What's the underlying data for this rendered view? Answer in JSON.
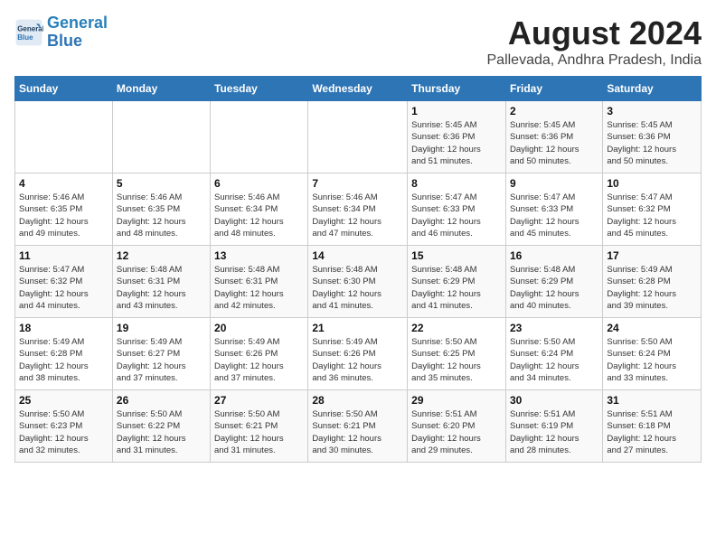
{
  "header": {
    "logo_line1": "General",
    "logo_line2": "Blue",
    "title": "August 2024",
    "subtitle": "Pallevada, Andhra Pradesh, India"
  },
  "days_of_week": [
    "Sunday",
    "Monday",
    "Tuesday",
    "Wednesday",
    "Thursday",
    "Friday",
    "Saturday"
  ],
  "weeks": [
    [
      {
        "day": "",
        "info": ""
      },
      {
        "day": "",
        "info": ""
      },
      {
        "day": "",
        "info": ""
      },
      {
        "day": "",
        "info": ""
      },
      {
        "day": "1",
        "info": "Sunrise: 5:45 AM\nSunset: 6:36 PM\nDaylight: 12 hours\nand 51 minutes."
      },
      {
        "day": "2",
        "info": "Sunrise: 5:45 AM\nSunset: 6:36 PM\nDaylight: 12 hours\nand 50 minutes."
      },
      {
        "day": "3",
        "info": "Sunrise: 5:45 AM\nSunset: 6:36 PM\nDaylight: 12 hours\nand 50 minutes."
      }
    ],
    [
      {
        "day": "4",
        "info": "Sunrise: 5:46 AM\nSunset: 6:35 PM\nDaylight: 12 hours\nand 49 minutes."
      },
      {
        "day": "5",
        "info": "Sunrise: 5:46 AM\nSunset: 6:35 PM\nDaylight: 12 hours\nand 48 minutes."
      },
      {
        "day": "6",
        "info": "Sunrise: 5:46 AM\nSunset: 6:34 PM\nDaylight: 12 hours\nand 48 minutes."
      },
      {
        "day": "7",
        "info": "Sunrise: 5:46 AM\nSunset: 6:34 PM\nDaylight: 12 hours\nand 47 minutes."
      },
      {
        "day": "8",
        "info": "Sunrise: 5:47 AM\nSunset: 6:33 PM\nDaylight: 12 hours\nand 46 minutes."
      },
      {
        "day": "9",
        "info": "Sunrise: 5:47 AM\nSunset: 6:33 PM\nDaylight: 12 hours\nand 45 minutes."
      },
      {
        "day": "10",
        "info": "Sunrise: 5:47 AM\nSunset: 6:32 PM\nDaylight: 12 hours\nand 45 minutes."
      }
    ],
    [
      {
        "day": "11",
        "info": "Sunrise: 5:47 AM\nSunset: 6:32 PM\nDaylight: 12 hours\nand 44 minutes."
      },
      {
        "day": "12",
        "info": "Sunrise: 5:48 AM\nSunset: 6:31 PM\nDaylight: 12 hours\nand 43 minutes."
      },
      {
        "day": "13",
        "info": "Sunrise: 5:48 AM\nSunset: 6:31 PM\nDaylight: 12 hours\nand 42 minutes."
      },
      {
        "day": "14",
        "info": "Sunrise: 5:48 AM\nSunset: 6:30 PM\nDaylight: 12 hours\nand 41 minutes."
      },
      {
        "day": "15",
        "info": "Sunrise: 5:48 AM\nSunset: 6:29 PM\nDaylight: 12 hours\nand 41 minutes."
      },
      {
        "day": "16",
        "info": "Sunrise: 5:48 AM\nSunset: 6:29 PM\nDaylight: 12 hours\nand 40 minutes."
      },
      {
        "day": "17",
        "info": "Sunrise: 5:49 AM\nSunset: 6:28 PM\nDaylight: 12 hours\nand 39 minutes."
      }
    ],
    [
      {
        "day": "18",
        "info": "Sunrise: 5:49 AM\nSunset: 6:28 PM\nDaylight: 12 hours\nand 38 minutes."
      },
      {
        "day": "19",
        "info": "Sunrise: 5:49 AM\nSunset: 6:27 PM\nDaylight: 12 hours\nand 37 minutes."
      },
      {
        "day": "20",
        "info": "Sunrise: 5:49 AM\nSunset: 6:26 PM\nDaylight: 12 hours\nand 37 minutes."
      },
      {
        "day": "21",
        "info": "Sunrise: 5:49 AM\nSunset: 6:26 PM\nDaylight: 12 hours\nand 36 minutes."
      },
      {
        "day": "22",
        "info": "Sunrise: 5:50 AM\nSunset: 6:25 PM\nDaylight: 12 hours\nand 35 minutes."
      },
      {
        "day": "23",
        "info": "Sunrise: 5:50 AM\nSunset: 6:24 PM\nDaylight: 12 hours\nand 34 minutes."
      },
      {
        "day": "24",
        "info": "Sunrise: 5:50 AM\nSunset: 6:24 PM\nDaylight: 12 hours\nand 33 minutes."
      }
    ],
    [
      {
        "day": "25",
        "info": "Sunrise: 5:50 AM\nSunset: 6:23 PM\nDaylight: 12 hours\nand 32 minutes."
      },
      {
        "day": "26",
        "info": "Sunrise: 5:50 AM\nSunset: 6:22 PM\nDaylight: 12 hours\nand 31 minutes."
      },
      {
        "day": "27",
        "info": "Sunrise: 5:50 AM\nSunset: 6:21 PM\nDaylight: 12 hours\nand 31 minutes."
      },
      {
        "day": "28",
        "info": "Sunrise: 5:50 AM\nSunset: 6:21 PM\nDaylight: 12 hours\nand 30 minutes."
      },
      {
        "day": "29",
        "info": "Sunrise: 5:51 AM\nSunset: 6:20 PM\nDaylight: 12 hours\nand 29 minutes."
      },
      {
        "day": "30",
        "info": "Sunrise: 5:51 AM\nSunset: 6:19 PM\nDaylight: 12 hours\nand 28 minutes."
      },
      {
        "day": "31",
        "info": "Sunrise: 5:51 AM\nSunset: 6:18 PM\nDaylight: 12 hours\nand 27 minutes."
      }
    ]
  ]
}
